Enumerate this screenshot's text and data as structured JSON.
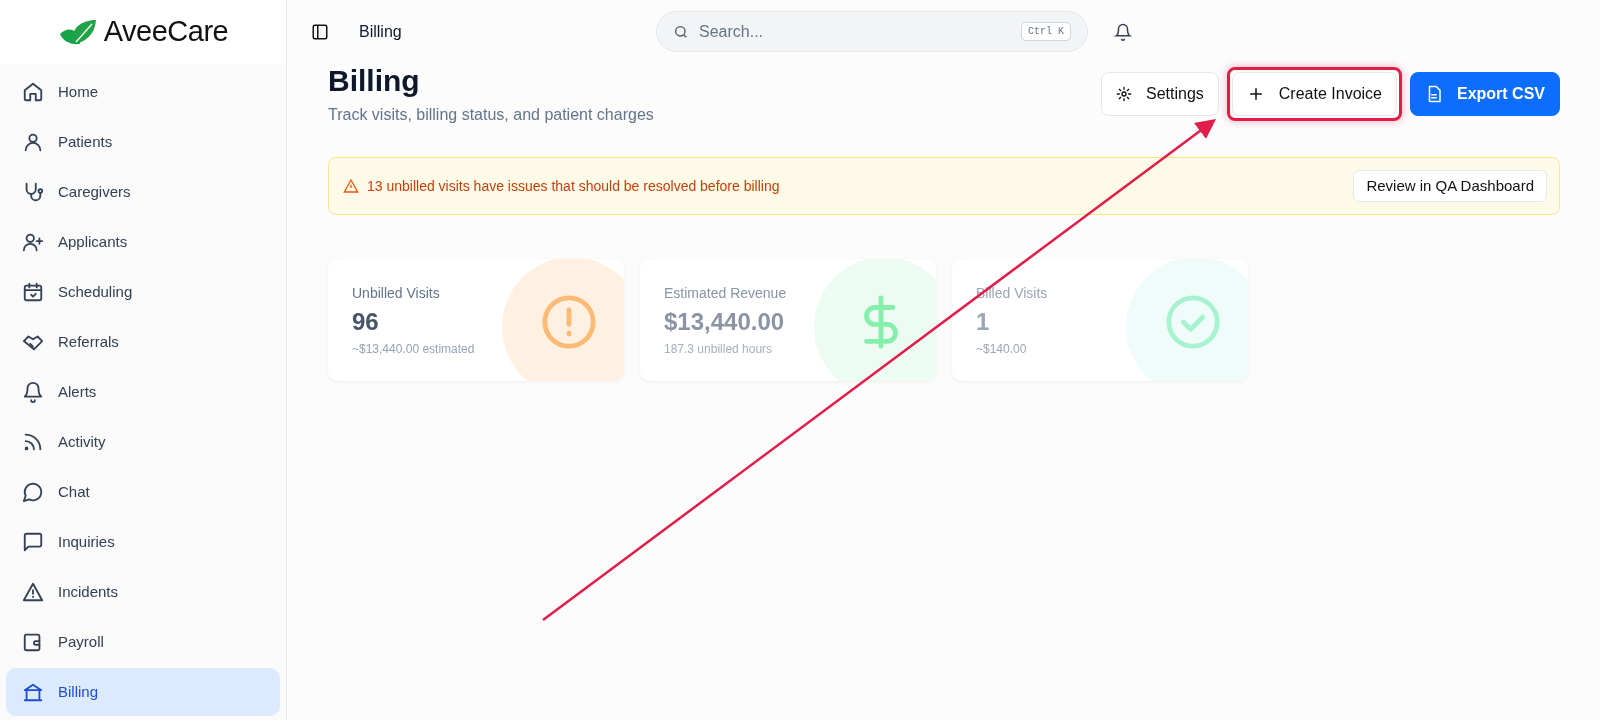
{
  "brand": {
    "name": "AveeCare"
  },
  "sidebar": {
    "items": [
      {
        "label": "Home",
        "selected": false
      },
      {
        "label": "Patients",
        "selected": false
      },
      {
        "label": "Caregivers",
        "selected": false
      },
      {
        "label": "Applicants",
        "selected": false
      },
      {
        "label": "Scheduling",
        "selected": false
      },
      {
        "label": "Referrals",
        "selected": false
      },
      {
        "label": "Alerts",
        "selected": false
      },
      {
        "label": "Activity",
        "selected": false
      },
      {
        "label": "Chat",
        "selected": false
      },
      {
        "label": "Inquiries",
        "selected": false
      },
      {
        "label": "Incidents",
        "selected": false
      },
      {
        "label": "Payroll",
        "selected": false
      },
      {
        "label": "Billing",
        "selected": true
      }
    ]
  },
  "topbar": {
    "breadcrumb": "Billing",
    "search": {
      "placeholder": "Search...",
      "shortcut": "Ctrl K"
    }
  },
  "page": {
    "title": "Billing",
    "subtitle": "Track visits, billing status, and patient charges"
  },
  "actions": [
    {
      "label": "Settings",
      "kind": "outline",
      "highlighted": false
    },
    {
      "label": "Create Invoice",
      "kind": "outline",
      "highlighted": true
    },
    {
      "label": "Export CSV",
      "kind": "primary",
      "highlighted": false
    }
  ],
  "alert": {
    "message": "13 unbilled visits have issues that should be resolved before billing",
    "button": "Review in QA Dashboard"
  },
  "stats": [
    {
      "label": "Unbilled Visits",
      "value": "96",
      "note": "~$13,440.00 estimated",
      "color": "#fff1e2"
    },
    {
      "label": "Estimated Revenue",
      "value": "$13,440.00",
      "note": "187.3 unbilled hours",
      "color": "#edfcf2"
    },
    {
      "label": "Billed Visits",
      "value": "1",
      "note": "~$140.00",
      "color": "#f0fcf9"
    }
  ]
}
